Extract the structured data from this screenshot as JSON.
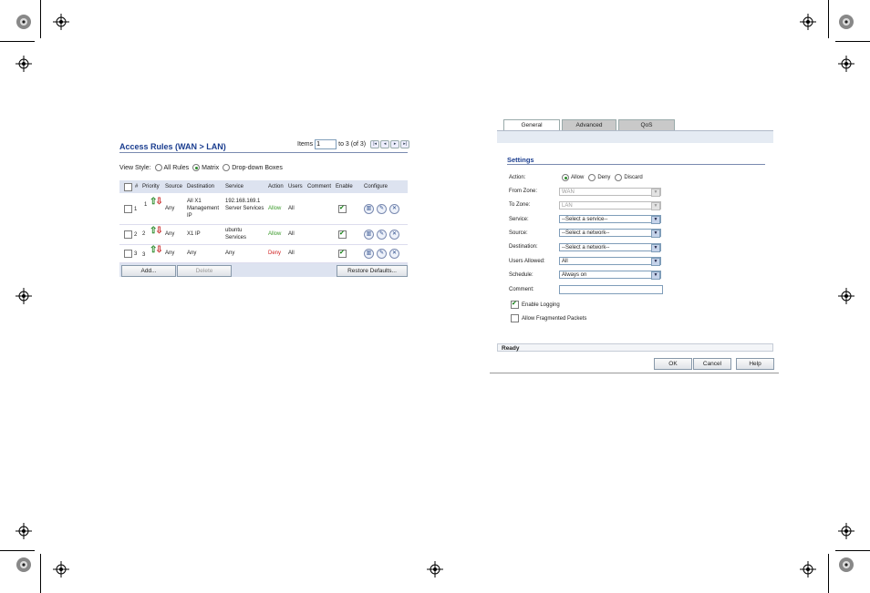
{
  "access_rules": {
    "title": "Access Rules (WAN > LAN)",
    "items_label": "Items",
    "items_value": "1",
    "items_range": "to 3 (of 3)",
    "view_style_label": "View Style:",
    "view_options": [
      "All Rules",
      "Matrix",
      "Drop-down Boxes"
    ],
    "view_selected": "Matrix",
    "columns": [
      "#",
      "Priority",
      "Source",
      "Destination",
      "Service",
      "Action",
      "Users",
      "Comment",
      "Enable",
      "Configure"
    ],
    "rows": [
      {
        "num": "1",
        "priority": "1",
        "source": "Any",
        "destination": "All X1 Management IP",
        "service": "192.168.169.1 Server Services",
        "action": "Allow",
        "users": "All",
        "comment": "",
        "enabled": true
      },
      {
        "num": "2",
        "priority": "2",
        "source": "Any",
        "destination": "X1 IP",
        "service": "ubuntu Services",
        "action": "Allow",
        "users": "All",
        "comment": "",
        "enabled": true
      },
      {
        "num": "3",
        "priority": "3",
        "source": "Any",
        "destination": "Any",
        "service": "Any",
        "action": "Deny",
        "users": "All",
        "comment": "",
        "enabled": true
      }
    ],
    "add_button": "Add...",
    "delete_button": "Delete",
    "restore_button": "Restore Defaults..."
  },
  "rule_dialog": {
    "tabs": [
      "General",
      "Advanced",
      "QoS"
    ],
    "active_tab": "General",
    "section_title": "Settings",
    "action_label": "Action:",
    "action_options": [
      "Allow",
      "Deny",
      "Discard"
    ],
    "action_selected": "Allow",
    "from_zone_label": "From Zone:",
    "from_zone_value": "WAN",
    "to_zone_label": "To Zone:",
    "to_zone_value": "LAN",
    "service_label": "Service:",
    "service_value": "--Select a service--",
    "source_label": "Source:",
    "source_value": "--Select a network--",
    "destination_label": "Destination:",
    "destination_value": "--Select a network--",
    "users_label": "Users Allowed:",
    "users_value": "All",
    "schedule_label": "Schedule:",
    "schedule_value": "Always on",
    "comment_label": "Comment:",
    "comment_value": "",
    "enable_logging_label": "Enable Logging",
    "enable_logging": true,
    "fragmented_label": "Allow Fragmented Packets",
    "fragmented": false,
    "status": "Ready",
    "ok_button": "OK",
    "cancel_button": "Cancel",
    "help_button": "Help"
  }
}
